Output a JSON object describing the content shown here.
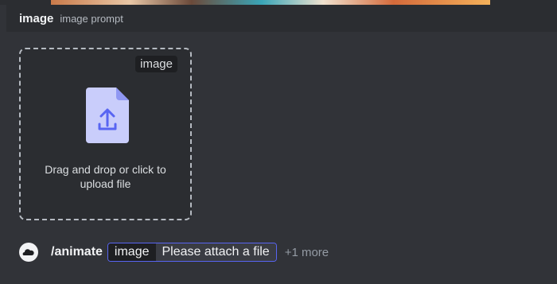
{
  "header": {
    "title": "image",
    "subtitle": "image prompt"
  },
  "dropzone": {
    "tag": "image",
    "text": "Drag and drop or click to upload file",
    "icon": "file-upload-icon"
  },
  "command_bar": {
    "avatar_icon": "bot-avatar-icon",
    "command": "/animate",
    "option_name": "image",
    "option_value": "Please attach a file",
    "more": "+1 more"
  },
  "colors": {
    "accent": "#5865f2",
    "background": "#313338",
    "header_bg": "#2b2d31",
    "file_icon": "#c9cdfb"
  }
}
